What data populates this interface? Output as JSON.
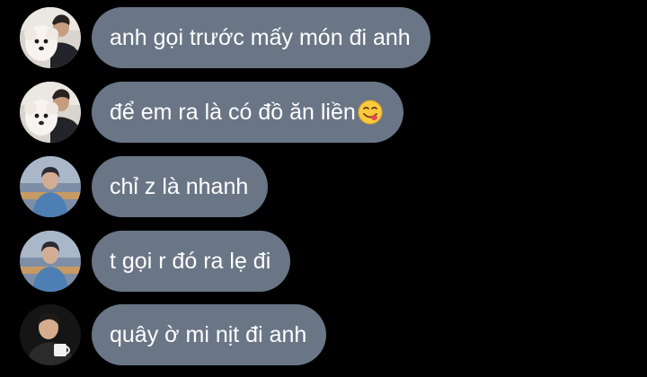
{
  "conversation": {
    "messages": [
      {
        "avatar": "avatar-man-with-white-dog",
        "text": "anh gọi trước mấy món đi anh"
      },
      {
        "avatar": "avatar-man-with-white-dog",
        "text": "để em ra là có đồ ăn liền",
        "emoji": "face-savoring-food-emoji"
      },
      {
        "avatar": "avatar-person-blue-hoodie",
        "text": "chỉ z là nhanh"
      },
      {
        "avatar": "avatar-person-blue-hoodie",
        "text": "t gọi r đó ra lẹ đi"
      },
      {
        "avatar": "avatar-man-with-mug",
        "text": "quây ờ mi nịt đi anh"
      }
    ]
  },
  "colors": {
    "background": "#000000",
    "bubble": "#6a7686",
    "text": "#ffffff"
  }
}
